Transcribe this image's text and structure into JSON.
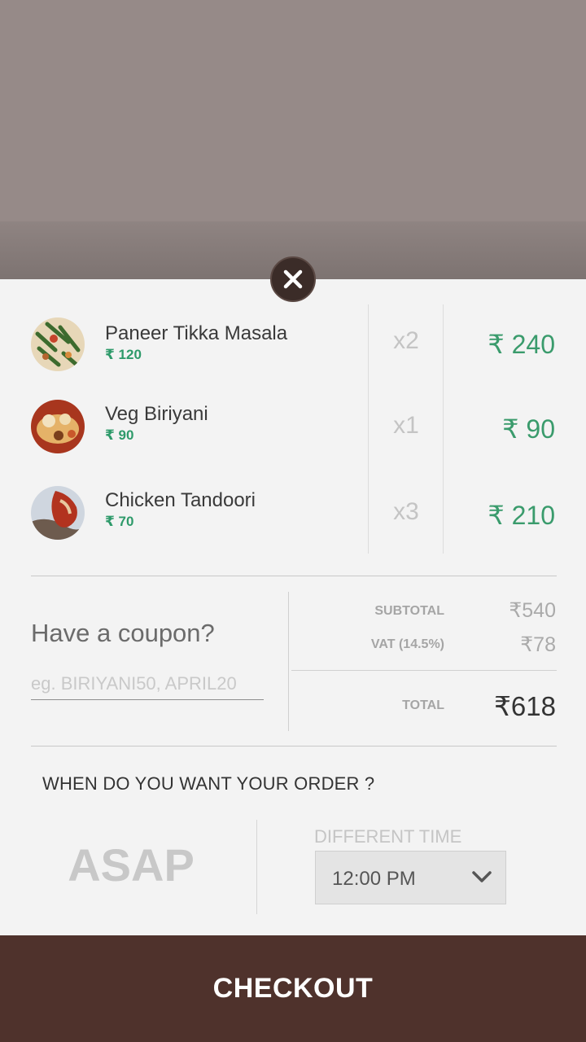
{
  "order": {
    "items": [
      {
        "name": "Paneer Tikka Masala",
        "unit_price": "₹ 120",
        "qty": "x2",
        "total": "₹ 240"
      },
      {
        "name": "Veg Biriyani",
        "unit_price": "₹ 90",
        "qty": "x1",
        "total": "₹ 90"
      },
      {
        "name": "Chicken Tandoori",
        "unit_price": "₹ 70",
        "qty": "x3",
        "total": "₹ 210"
      }
    ]
  },
  "coupon": {
    "title": "Have a coupon?",
    "placeholder": "eg. BIRIYANI50, APRIL20"
  },
  "summary": {
    "subtotal_label": "SUBTOTAL",
    "subtotal_value": "₹540",
    "vat_label": "VAT (14.5%)",
    "vat_value": "₹78",
    "total_label": "TOTAL",
    "total_value": "₹618"
  },
  "timing": {
    "question": "WHEN DO YOU WANT YOUR ORDER ?",
    "asap_label": "ASAP",
    "different_time_label": "DIFFERENT TIME",
    "selected_time": "12:00 PM"
  },
  "checkout_label": "CHECKOUT",
  "icons": {
    "close": "close-icon",
    "dropdown": "chevron-down-icon"
  },
  "colors": {
    "accent_green": "#3a9b6c",
    "checkout_bg": "#4f322c",
    "close_bg": "#3b2c28"
  }
}
